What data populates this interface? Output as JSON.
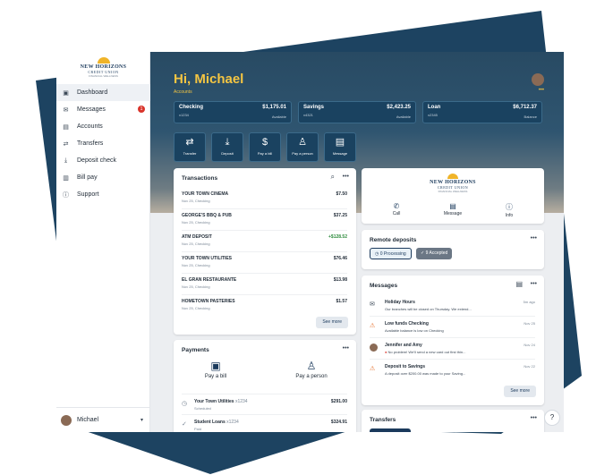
{
  "brand": {
    "logo_line1": "NEW HORIZONS",
    "logo_line2": "CREDIT UNION",
    "logo_line3": "FINANCIAL WELLNESS"
  },
  "sidebar": {
    "items": [
      {
        "label": "Dashboard",
        "icon": "dashboard-icon",
        "active": true
      },
      {
        "label": "Messages",
        "icon": "mail-icon",
        "badge": "1"
      },
      {
        "label": "Accounts",
        "icon": "accounts-icon"
      },
      {
        "label": "Transfers",
        "icon": "transfer-icon"
      },
      {
        "label": "Deposit check",
        "icon": "deposit-icon"
      },
      {
        "label": "Bill pay",
        "icon": "bill-icon"
      },
      {
        "label": "Support",
        "icon": "help-icon"
      }
    ],
    "user": {
      "name": "Michael"
    }
  },
  "header": {
    "greeting": "Hi, Michael",
    "accounts_label": "Accounts",
    "more": "•••"
  },
  "accounts": [
    {
      "name": "Checking",
      "number": "x1234",
      "amount": "$1,175.01",
      "label": "Available"
    },
    {
      "name": "Savings",
      "number": "x4321",
      "amount": "$2,423.25",
      "label": "Available"
    },
    {
      "name": "Loan",
      "number": "x2345",
      "amount": "$6,712.37",
      "label": "Balance"
    }
  ],
  "quick_actions": [
    {
      "label": "Transfer",
      "icon": "transfer-icon"
    },
    {
      "label": "Deposit",
      "icon": "deposit-icon"
    },
    {
      "label": "Pay a bill",
      "icon": "bill-icon"
    },
    {
      "label": "Pay a person",
      "icon": "person-icon"
    },
    {
      "label": "Message",
      "icon": "message-icon"
    }
  ],
  "transactions": {
    "title": "Transactions",
    "rows": [
      {
        "name": "YOUR TOWN CINEMA",
        "detail": "Nov 25, Checking",
        "amount": "$7.50"
      },
      {
        "name": "GEORGE'S BBQ & PUB",
        "detail": "Nov 25, Checking",
        "amount": "$37.25"
      },
      {
        "name": "ATM DEPOSIT",
        "detail": "Nov 25, Checking",
        "amount": "+$128.52"
      },
      {
        "name": "YOUR TOWN UTILITIES",
        "detail": "Nov 25, Checking",
        "amount": "$76.46"
      },
      {
        "name": "EL GRAN RESTAURANTE",
        "detail": "Nov 25, Checking",
        "amount": "$13.98"
      },
      {
        "name": "HOMETOWN PASTERIES",
        "detail": "Nov 25, Checking",
        "amount": "$1.57"
      }
    ],
    "see_more": "See more"
  },
  "payments": {
    "title": "Payments",
    "actions": [
      {
        "label": "Pay a bill"
      },
      {
        "label": "Pay a person"
      }
    ],
    "bills": [
      {
        "name": "Your Town Utilities",
        "account": "x1234",
        "status": "Scheduled",
        "amount": "$291.00"
      },
      {
        "name": "Student Loans",
        "account": "x1234",
        "status": "Paid",
        "amount": "$324.91"
      }
    ]
  },
  "credit_union": {
    "actions": [
      {
        "label": "Call"
      },
      {
        "label": "Message"
      },
      {
        "label": "Info"
      }
    ]
  },
  "remote_deposits": {
    "title": "Remote deposits",
    "processing": "0 Processing",
    "accepted": "9 Accepted"
  },
  "messages": {
    "title": "Messages",
    "rows": [
      {
        "title": "Holiday Hours",
        "body": "Our branches will be closed on Thursday. We extend...",
        "date": "5m ago"
      },
      {
        "title": "Low funds Checking",
        "body": "Available balance is low on Checking",
        "date": "Nov 25"
      },
      {
        "title": "Jennifer and Amy",
        "body": "No problem! We'll send a new card out first thin...",
        "date": "Nov 24"
      },
      {
        "title": "Deposit to Savings",
        "body": "A deposit over $200.00 was made to your Saving...",
        "date": "Nov 22"
      }
    ],
    "see_more": "See more"
  },
  "transfers": {
    "title": "Transfers"
  },
  "help": "?"
}
